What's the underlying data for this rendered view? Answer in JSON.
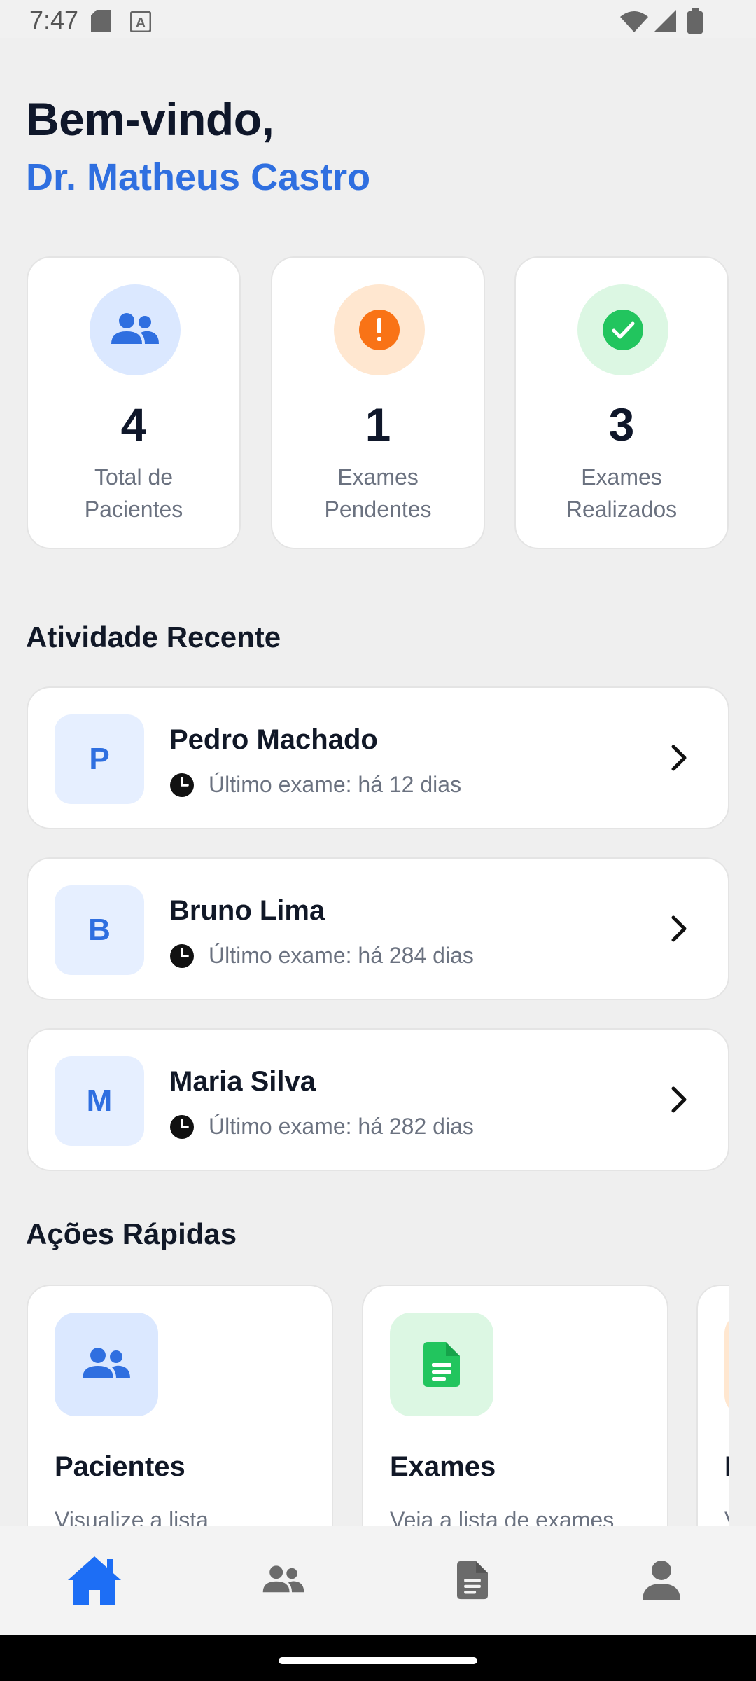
{
  "status_bar": {
    "time": "7:47"
  },
  "header": {
    "greeting": "Bem-vindo,",
    "doctor_name": "Dr. Matheus Castro"
  },
  "stats": [
    {
      "value": "4",
      "label_line1": "Total de",
      "label_line2": "Pacientes",
      "icon": "users-icon",
      "accent": "#2f6fe0"
    },
    {
      "value": "1",
      "label_line1": "Exames",
      "label_line2": "Pendentes",
      "icon": "alert-icon",
      "accent": "#f97316"
    },
    {
      "value": "3",
      "label_line1": "Exames",
      "label_line2": "Realizados",
      "icon": "check-icon",
      "accent": "#22c55e"
    }
  ],
  "recent_activity": {
    "title": "Atividade Recente",
    "items": [
      {
        "initial": "P",
        "name": "Pedro Machado",
        "last_exam": "Último exame: há 12 dias"
      },
      {
        "initial": "B",
        "name": "Bruno Lima",
        "last_exam": "Último exame: há 284 dias"
      },
      {
        "initial": "M",
        "name": "Maria Silva",
        "last_exam": "Último exame: há 282 dias"
      }
    ]
  },
  "quick_actions": {
    "title": "Ações Rápidas",
    "items": [
      {
        "title": "Pacientes",
        "description": "Visualize a lista",
        "icon": "users-icon"
      },
      {
        "title": "Exames",
        "description": "Veja a lista de exames",
        "icon": "document-icon"
      },
      {
        "title": "R",
        "description": "V",
        "icon": ""
      }
    ]
  },
  "bottom_nav": [
    {
      "name": "home",
      "icon": "home-icon",
      "active": true
    },
    {
      "name": "patients",
      "icon": "users-icon",
      "active": false
    },
    {
      "name": "exams",
      "icon": "document-icon",
      "active": false
    },
    {
      "name": "profile",
      "icon": "person-icon",
      "active": false
    }
  ],
  "colors": {
    "primary": "#2f6fe0",
    "warning": "#f97316",
    "success": "#22c55e",
    "background": "#efefef"
  }
}
